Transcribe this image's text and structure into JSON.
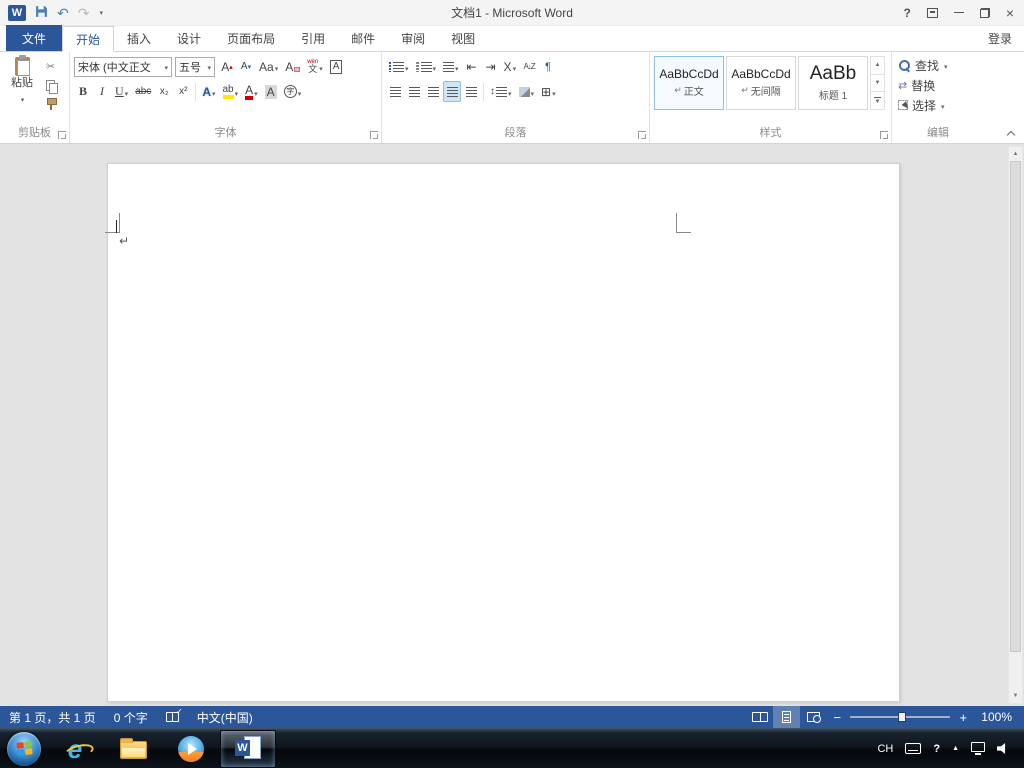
{
  "titlebar": {
    "title": "文档1 - Microsoft Word"
  },
  "tabs": {
    "file": "文件",
    "items": [
      "开始",
      "插入",
      "设计",
      "页面布局",
      "引用",
      "邮件",
      "审阅",
      "视图"
    ],
    "sign_in": "登录"
  },
  "ribbon": {
    "groups": {
      "clipboard": "剪贴板",
      "font": "字体",
      "paragraph": "段落",
      "styles": "样式",
      "editing": "编辑"
    },
    "clipboard": {
      "paste": "粘贴"
    },
    "font": {
      "name": "宋体 (中文正文",
      "size": "五号",
      "grow": "A",
      "shrink": "A",
      "case": "Aa",
      "clear": "A",
      "phonetic_top": "wén",
      "phonetic_bottom": "文",
      "char_border": "A",
      "bold": "B",
      "italic": "I",
      "underline": "U",
      "strike": "abc",
      "subscript": "x₂",
      "superscript": "x²",
      "effects": "A",
      "highlight": "ab",
      "color": "A",
      "shading": "A",
      "enclose": "字"
    },
    "paragraph": {
      "asian_layout": "X",
      "sort": "A↓Z",
      "show_marks": "¶",
      "line_spacing": "↕"
    },
    "styles": {
      "items": [
        {
          "preview": "AaBbCcDd",
          "mark": "↵",
          "name": "正文"
        },
        {
          "preview": "AaBbCcDd",
          "mark": "↵",
          "name": "无间隔"
        },
        {
          "preview": "AaBb",
          "mark": "",
          "name": "标题 1"
        }
      ]
    },
    "editing": {
      "find": "查找",
      "replace": "替换",
      "select": "选择"
    }
  },
  "document": {
    "paragraph_mark": "↵"
  },
  "statusbar": {
    "page_info": "第 1 页，共 1 页",
    "word_count": "0 个字",
    "language": "中文(中国)",
    "zoom_level": "100%"
  },
  "taskbar": {
    "language_indicator": "CH"
  },
  "icons": {
    "undo": "↶",
    "redo": "↷",
    "help": "?",
    "close": "×",
    "cut": "✂",
    "outdent": "⇤",
    "indent": "⇥",
    "borders": "⊞",
    "replace": "⇄",
    "zoom_out": "−",
    "zoom_in": "+",
    "scroll_up": "▲",
    "scroll_down": "▼",
    "tray_help": "?",
    "hidden_icons": "▲",
    "word": "W",
    "ie": "e"
  }
}
